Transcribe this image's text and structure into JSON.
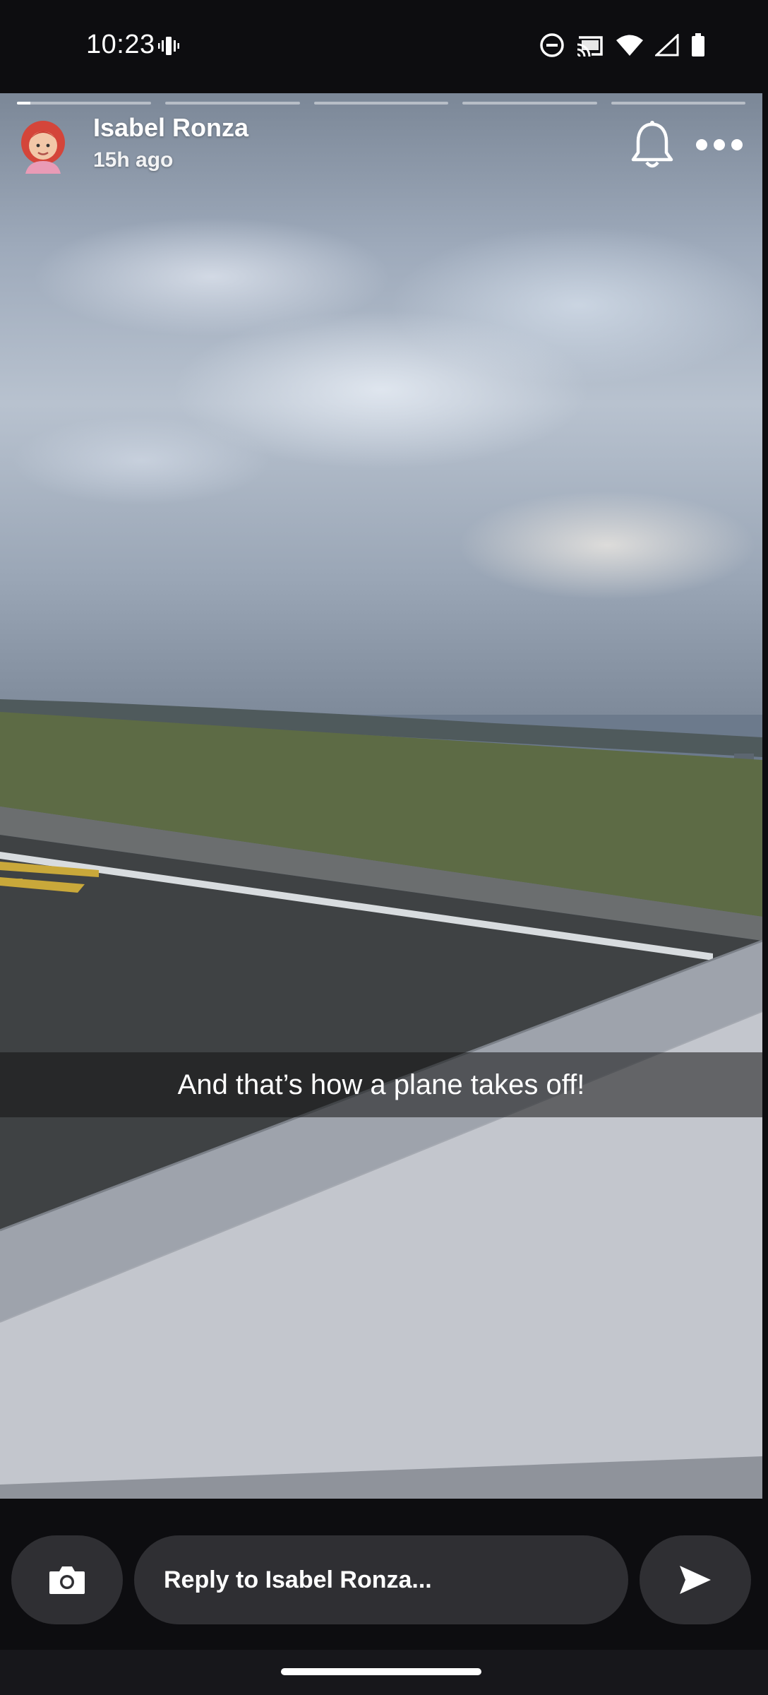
{
  "status_bar": {
    "time": "10:23",
    "icons": [
      "vibrate-icon",
      "do-not-disturb-icon",
      "cast-icon",
      "wifi-icon",
      "cell-signal-icon",
      "battery-icon"
    ]
  },
  "story": {
    "progress": {
      "segments": 5,
      "active_index": 0,
      "active_fraction": 0.1
    },
    "user_name": "Isabel Ronza",
    "time_ago": "15h ago",
    "caption": "And that’s how a plane takes off!",
    "header_icons": [
      "bell-icon",
      "more-icon"
    ]
  },
  "reply_bar": {
    "placeholder": "Reply to Isabel Ronza...",
    "icons": [
      "camera-icon",
      "send-icon"
    ]
  },
  "colors": {
    "background": "#0d0d10",
    "pill": "#2f2f33",
    "text": "#ffffff"
  }
}
